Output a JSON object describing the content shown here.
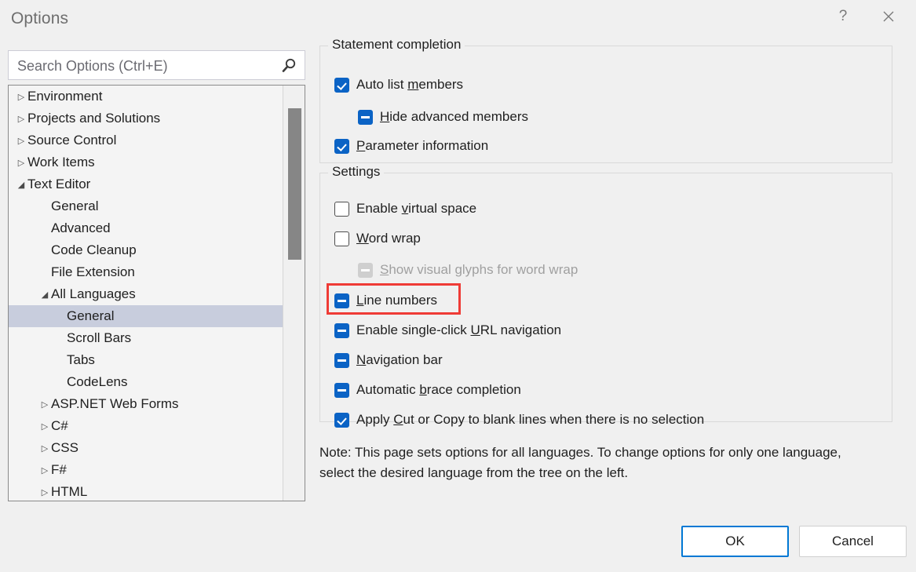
{
  "window": {
    "title": "Options",
    "help_label": "?",
    "close_label": "Close",
    "colors": {
      "background": "#f0f0f0",
      "accent": "#0b63c5",
      "focus": "#0078d4",
      "selection": "#c8cddd",
      "highlight": "#ef3b36"
    }
  },
  "search": {
    "placeholder": "Search Options (Ctrl+E)",
    "value": "",
    "icon": "search-icon"
  },
  "tree": {
    "items": [
      {
        "label": "Environment",
        "level": 0,
        "twisty": "collapsed",
        "selected": false
      },
      {
        "label": "Projects and Solutions",
        "level": 0,
        "twisty": "collapsed",
        "selected": false
      },
      {
        "label": "Source Control",
        "level": 0,
        "twisty": "collapsed",
        "selected": false
      },
      {
        "label": "Work Items",
        "level": 0,
        "twisty": "collapsed",
        "selected": false
      },
      {
        "label": "Text Editor",
        "level": 0,
        "twisty": "expanded",
        "selected": false
      },
      {
        "label": "General",
        "level": 1,
        "twisty": "none",
        "selected": false
      },
      {
        "label": "Advanced",
        "level": 1,
        "twisty": "none",
        "selected": false
      },
      {
        "label": "Code Cleanup",
        "level": 1,
        "twisty": "none",
        "selected": false
      },
      {
        "label": "File Extension",
        "level": 1,
        "twisty": "none",
        "selected": false
      },
      {
        "label": "All Languages",
        "level": 1,
        "twisty": "expanded",
        "selected": false
      },
      {
        "label": "General",
        "level": 2,
        "twisty": "none",
        "selected": true
      },
      {
        "label": "Scroll Bars",
        "level": 2,
        "twisty": "none",
        "selected": false
      },
      {
        "label": "Tabs",
        "level": 2,
        "twisty": "none",
        "selected": false
      },
      {
        "label": "CodeLens",
        "level": 2,
        "twisty": "none",
        "selected": false
      },
      {
        "label": "ASP.NET Web Forms",
        "level": 1,
        "twisty": "collapsed",
        "selected": false
      },
      {
        "label": "C#",
        "level": 1,
        "twisty": "collapsed",
        "selected": false
      },
      {
        "label": "CSS",
        "level": 1,
        "twisty": "collapsed",
        "selected": false
      },
      {
        "label": "F#",
        "level": 1,
        "twisty": "collapsed",
        "selected": false
      },
      {
        "label": "HTML",
        "level": 1,
        "twisty": "collapsed",
        "selected": false
      }
    ]
  },
  "statement_completion": {
    "title": "Statement completion",
    "options": [
      {
        "label_before": "Auto list ",
        "mnemonic": "m",
        "label_after": "embers",
        "state": "checked",
        "disabled": false,
        "indent": 0
      },
      {
        "label_before": "",
        "mnemonic": "H",
        "label_after": "ide advanced members",
        "state": "mixed",
        "disabled": false,
        "indent": 1
      },
      {
        "label_before": "",
        "mnemonic": "P",
        "label_after": "arameter information",
        "state": "checked",
        "disabled": false,
        "indent": 0
      }
    ]
  },
  "settings": {
    "title": "Settings",
    "options": [
      {
        "label_before": "Enable ",
        "mnemonic": "v",
        "label_after": "irtual space",
        "state": "unchecked",
        "disabled": false,
        "indent": 0,
        "highlighted": false
      },
      {
        "label_before": "",
        "mnemonic": "W",
        "label_after": "ord wrap",
        "state": "unchecked",
        "disabled": false,
        "indent": 0,
        "highlighted": false
      },
      {
        "label_before": "",
        "mnemonic": "S",
        "label_after": "how visual glyphs for word wrap",
        "state": "mixed",
        "disabled": true,
        "indent": 1,
        "highlighted": false
      },
      {
        "label_before": "",
        "mnemonic": "L",
        "label_after": "ine numbers",
        "state": "mixed",
        "disabled": false,
        "indent": 0,
        "highlighted": true
      },
      {
        "label_before": "Enable single-click ",
        "mnemonic": "U",
        "label_after": "RL navigation",
        "state": "mixed",
        "disabled": false,
        "indent": 0,
        "highlighted": false
      },
      {
        "label_before": "",
        "mnemonic": "N",
        "label_after": "avigation bar",
        "state": "mixed",
        "disabled": false,
        "indent": 0,
        "highlighted": false
      },
      {
        "label_before": "Automatic ",
        "mnemonic": "b",
        "label_after": "race completion",
        "state": "mixed",
        "disabled": false,
        "indent": 0,
        "highlighted": false
      },
      {
        "label_before": "Apply ",
        "mnemonic": "C",
        "label_after": "ut or Copy to blank lines when there is no selection",
        "state": "checked",
        "disabled": false,
        "indent": 0,
        "highlighted": false
      }
    ]
  },
  "note": {
    "text": "Note: This page sets options for all languages. To change options for only one language, select the desired language from the tree on the left."
  },
  "footer": {
    "ok_label": "OK",
    "cancel_label": "Cancel"
  }
}
